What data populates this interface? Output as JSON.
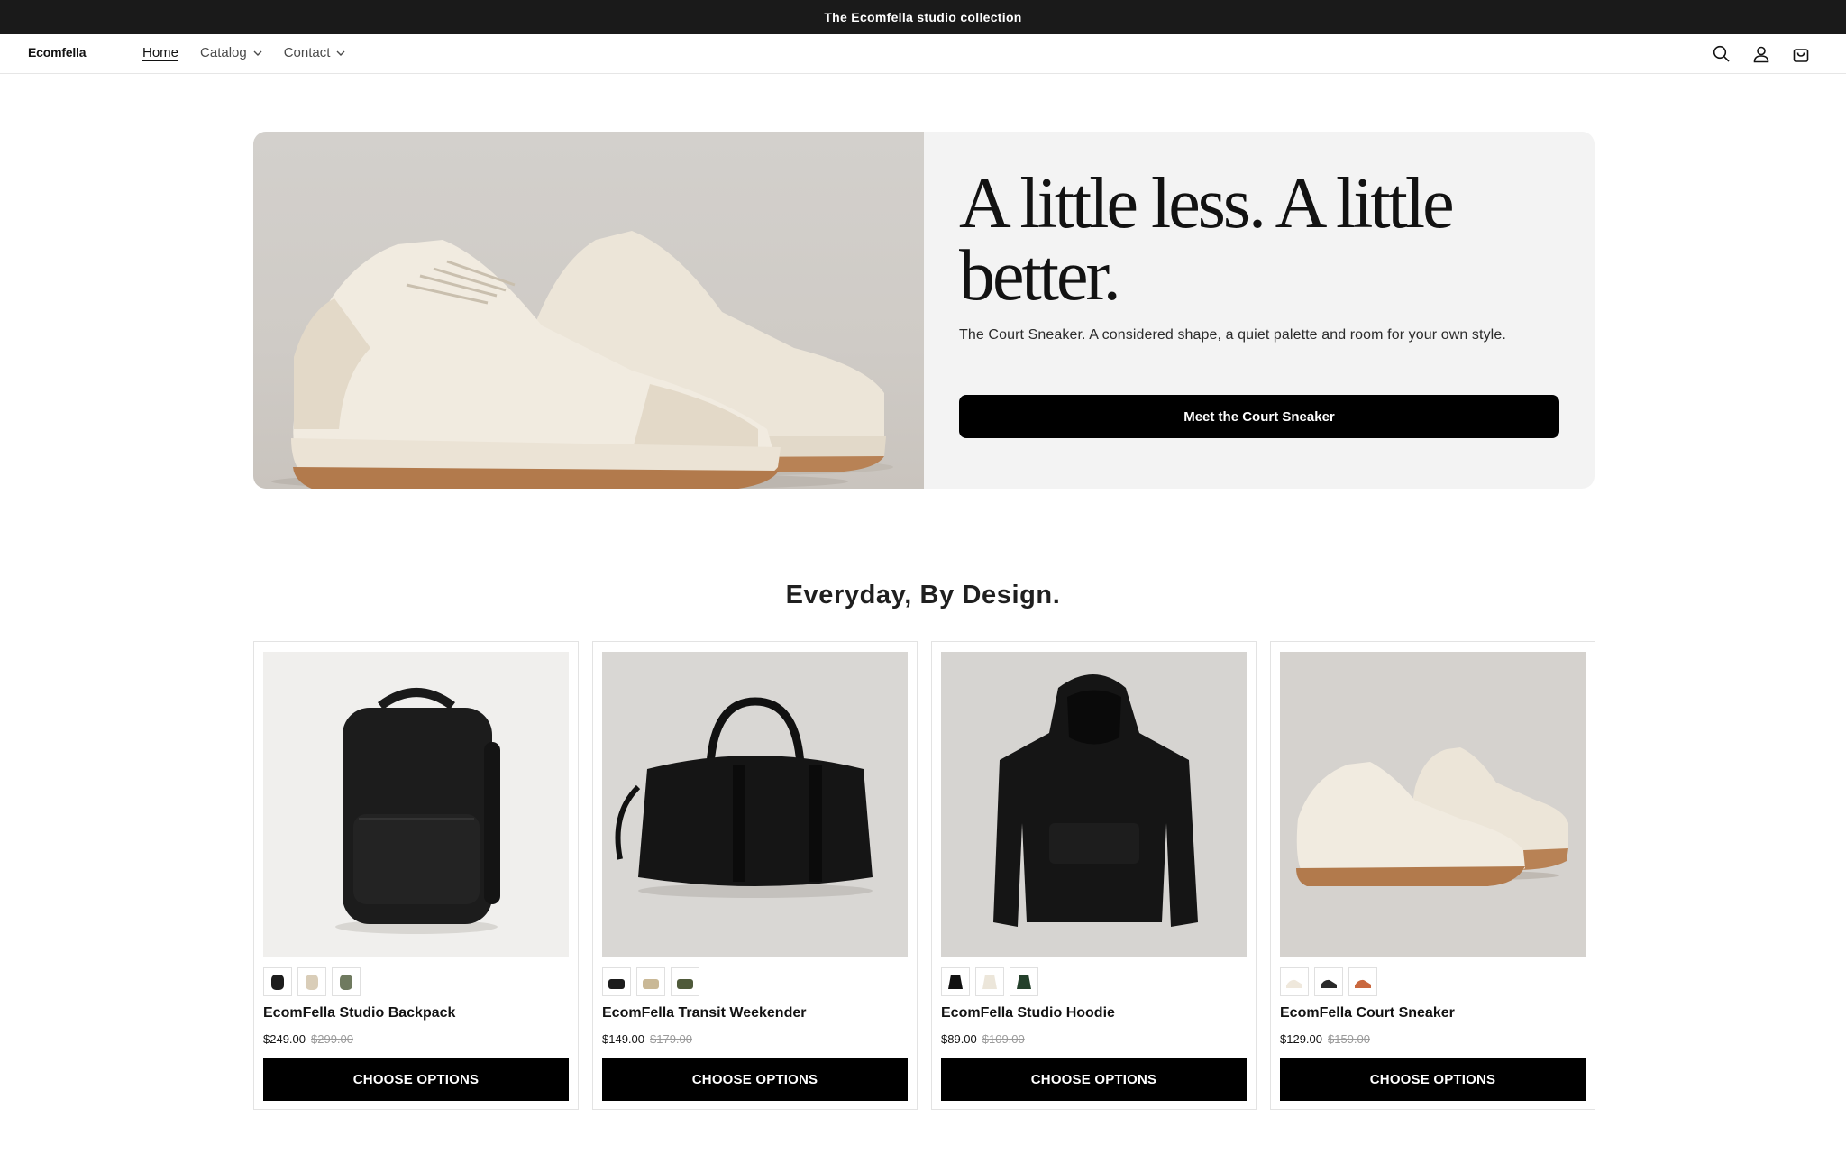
{
  "announcement": {
    "text": "The Ecomfella studio collection"
  },
  "header": {
    "logo": "Ecomfella",
    "nav": [
      {
        "label": "Home",
        "active": true
      },
      {
        "label": "Catalog",
        "dropdown": true
      },
      {
        "label": "Contact",
        "dropdown": true
      }
    ],
    "icons": [
      "search-icon",
      "account-icon",
      "cart-icon"
    ]
  },
  "hero": {
    "title": "A little less. A little better.",
    "subtitle": "The Court Sneaker. A considered shape, a quiet palette and room for your own style.",
    "button_label": "Meet the Court Sneaker"
  },
  "collection": {
    "title": "Everyday, By Design.",
    "products": [
      {
        "name": "EcomFella Studio Backpack",
        "price": "$249.00",
        "compare_price": "$299.00",
        "button_label": "CHOOSE OPTIONS",
        "swatches": [
          "#1c1c1c",
          "#d9cdb8",
          "#6f7a5f"
        ]
      },
      {
        "name": "EcomFella Transit Weekender",
        "price": "$149.00",
        "compare_price": "$179.00",
        "button_label": "CHOOSE OPTIONS",
        "swatches": [
          "#1c1c1c",
          "#c9b896",
          "#4f5a3a"
        ]
      },
      {
        "name": "EcomFella Studio Hoodie",
        "price": "$89.00",
        "compare_price": "$109.00",
        "button_label": "CHOOSE OPTIONS",
        "swatches": [
          "#111111",
          "#ece6da",
          "#24402b"
        ]
      },
      {
        "name": "EcomFella Court Sneaker",
        "price": "$129.00",
        "compare_price": "$159.00",
        "button_label": "CHOOSE OPTIONS",
        "swatches": [
          "#efe8dc",
          "#2a2a2a",
          "#c9683f"
        ]
      }
    ]
  },
  "colors": {
    "announcement_bg": "#1a1a1a",
    "button_bg": "#000000",
    "hero_bg": "#f3f3f3"
  }
}
